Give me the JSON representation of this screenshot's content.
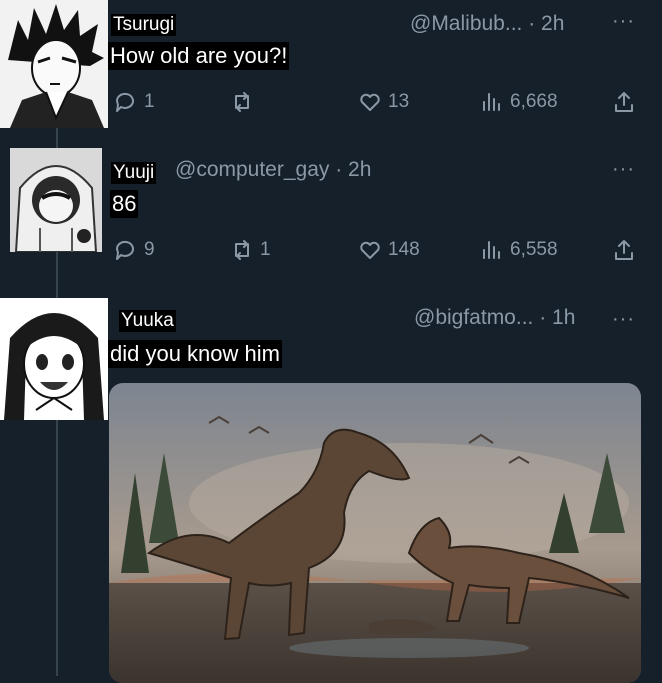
{
  "tweets": [
    {
      "name": "Tsurugi",
      "handle": "@Malibub... · 2h",
      "text": "How old are you?!",
      "replies": "1",
      "retweets": "",
      "likes": "13",
      "views": "6,668"
    },
    {
      "name": "Yuuji",
      "handle": "@computer_gay · 2h",
      "text": "86",
      "replies": "9",
      "retweets": "1",
      "likes": "148",
      "views": "6,558"
    },
    {
      "name": "Yuuka",
      "handle": "@bigfatmo... · 1h",
      "text": "did you know him"
    }
  ],
  "icons": {
    "reply": "reply-icon",
    "retweet": "retweet-icon",
    "like": "heart-icon",
    "views": "views-icon",
    "share": "share-icon",
    "more": "more-icon"
  },
  "colors": {
    "background": "#15202b",
    "muted": "#8b98a5",
    "text": "#e7e9ea"
  }
}
